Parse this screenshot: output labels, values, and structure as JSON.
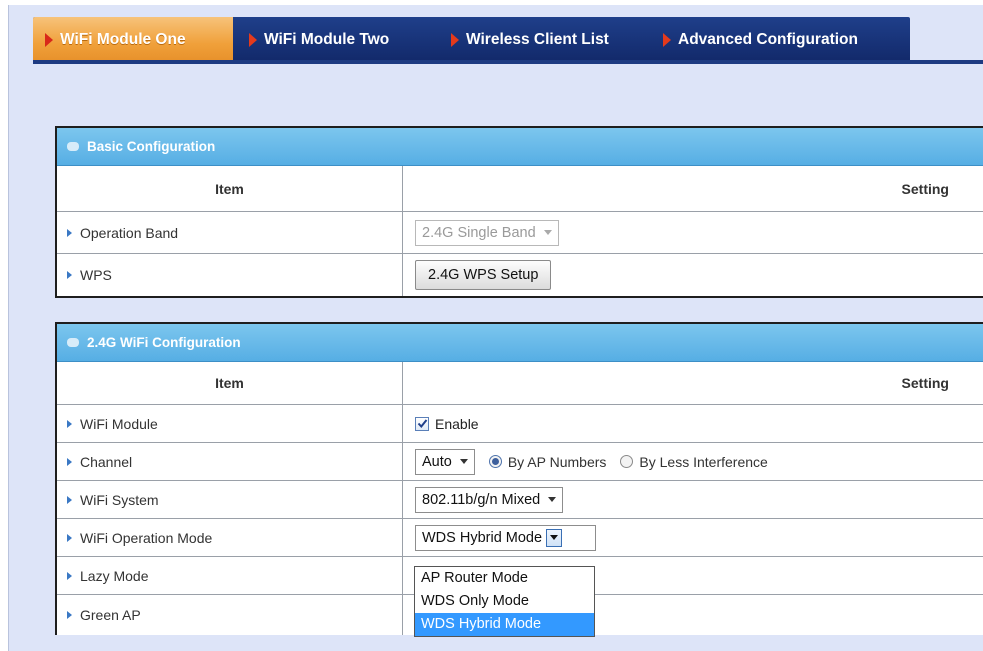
{
  "tabs": [
    {
      "label": "WiFi Module One",
      "active": true
    },
    {
      "label": "WiFi Module Two",
      "active": false
    },
    {
      "label": "Wireless Client List",
      "active": false
    },
    {
      "label": "Advanced Configuration",
      "active": false
    }
  ],
  "basic": {
    "title": "Basic Configuration",
    "col_item": "Item",
    "col_setting": "Setting",
    "operation_band": {
      "label": "Operation Band",
      "value": "2.4G Single Band"
    },
    "wps": {
      "label": "WPS",
      "button": "2.4G WPS Setup"
    }
  },
  "wifi24": {
    "title": "2.4G WiFi Configuration",
    "col_item": "Item",
    "col_setting": "Setting",
    "module": {
      "label": "WiFi Module",
      "checkbox_label": "Enable",
      "checked": true
    },
    "channel": {
      "label": "Channel",
      "value": "Auto",
      "radio_1": "By AP Numbers",
      "radio_2": "By Less Interference",
      "selected_radio": "By AP Numbers"
    },
    "system": {
      "label": "WiFi System",
      "value": "802.11b/g/n Mixed"
    },
    "op_mode": {
      "label": "WiFi Operation Mode",
      "value": "WDS Hybrid Mode",
      "options": [
        "AP Router Mode",
        "WDS Only Mode",
        "WDS Hybrid Mode"
      ]
    },
    "lazy_mode": {
      "label": "Lazy Mode"
    },
    "green_ap": {
      "label": "Green AP"
    }
  },
  "colors": {
    "tab_bar": "#1f3f8a",
    "tab_active": "#f0a03a",
    "panel_header": "#62b6e8",
    "page_bg": "#dde4f8",
    "selected_option": "#3399ff"
  }
}
